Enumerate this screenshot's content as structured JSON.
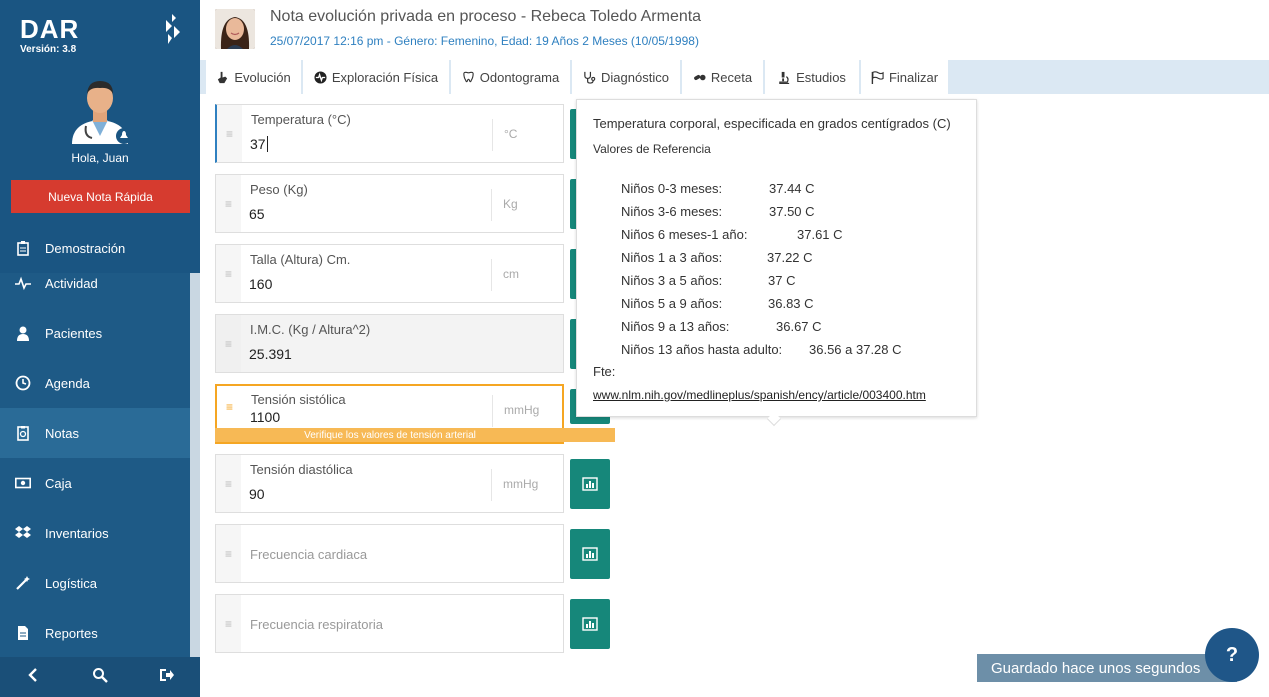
{
  "app": {
    "logo": "DAR",
    "version": "Versión: 3.8"
  },
  "colors": {
    "sidebar": "#1e5a86",
    "accent_button": "#d63b2f",
    "chart_button": "#16877a",
    "warning": "#f5a623",
    "link_blue": "#2f80c0"
  },
  "user": {
    "greeting": "Hola, Juan",
    "avatar_icon": "doctor-avatar-icon"
  },
  "sidebar": {
    "quick_note_label": "Nueva Nota Rápida",
    "items": [
      {
        "label": "Demostración",
        "icon": "clipboard-icon"
      },
      {
        "label": "Actividad",
        "icon": "pulse-icon"
      },
      {
        "label": "Pacientes",
        "icon": "user-icon"
      },
      {
        "label": "Agenda",
        "icon": "clock-icon"
      },
      {
        "label": "Notas",
        "icon": "notes-icon"
      },
      {
        "label": "Caja",
        "icon": "cash-icon"
      },
      {
        "label": "Inventarios",
        "icon": "dropbox-icon"
      },
      {
        "label": "Logística",
        "icon": "magic-wand-icon"
      },
      {
        "label": "Reportes",
        "icon": "document-icon"
      }
    ],
    "bottom": [
      "chevron-left-icon",
      "search-icon",
      "logout-icon"
    ]
  },
  "header": {
    "title": "Nota evolución privada en proceso - Rebeca Toledo Armenta",
    "subtitle": "25/07/2017 12:16 pm - Género: Femenino, Edad: 19 Años 2 Meses (10/05/1998)"
  },
  "tabs": [
    {
      "label": "Evolución",
      "icon": "hand-icon"
    },
    {
      "label": "Exploración Física",
      "icon": "heartbeat-icon"
    },
    {
      "label": "Odontograma",
      "icon": "tooth-icon"
    },
    {
      "label": "Diagnóstico",
      "icon": "stethoscope-icon"
    },
    {
      "label": "Receta",
      "icon": "pills-icon"
    },
    {
      "label": "Estudios",
      "icon": "microscope-icon"
    },
    {
      "label": "Finalizar",
      "icon": "flag-icon"
    }
  ],
  "fields": [
    {
      "label": "Temperatura (°C)",
      "value": "37",
      "unit": "°C"
    },
    {
      "label": "Peso (Kg)",
      "value": "65",
      "unit": "Kg"
    },
    {
      "label": "Talla (Altura) Cm.",
      "value": "160",
      "unit": "cm"
    },
    {
      "label": "I.M.C. (Kg / Altura^2)",
      "value": "25.391",
      "unit": ""
    },
    {
      "label": "Tensión sistólica",
      "value": "1100",
      "unit": "mmHg",
      "warning": "Verifique los valores de tensión arterial"
    },
    {
      "label": "Tensión diastólica",
      "value": "90",
      "unit": "mmHg"
    },
    {
      "placeholder": "Frecuencia cardiaca"
    },
    {
      "placeholder": "Frecuencia respiratoria"
    }
  ],
  "tooltip": {
    "title": "Temperatura corporal, especificada en grados centígrados (C)",
    "heading": "Valores de Referencia",
    "rows": [
      {
        "label": "Niños 0-3 meses:",
        "value": "37.44 C"
      },
      {
        "label": "Niños 3-6 meses:",
        "value": "37.50 C"
      },
      {
        "label": "Niños 6 meses-1 año:",
        "value": "37.61 C"
      },
      {
        "label": "Niños 1 a 3 años:",
        "value": "37.22 C"
      },
      {
        "label": "Niños 3 a 5 años:",
        "value": "37 C"
      },
      {
        "label": "Niños 5 a 9 años:",
        "value": "36.83 C"
      },
      {
        "label": "Niños 9 a 13 años:",
        "value": "36.67 C"
      },
      {
        "label": "Niños 13 años hasta adulto:",
        "value": "36.56 a 37.28 C"
      }
    ],
    "source_label": "Fte:",
    "link": "www.nlm.nih.gov/medlineplus/spanish/ency/article/003400.htm"
  },
  "status": {
    "saved": "Guardado hace unos segundos",
    "help": "?"
  }
}
